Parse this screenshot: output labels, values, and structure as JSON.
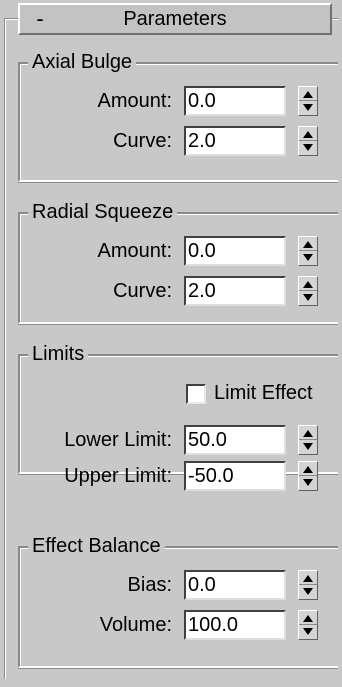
{
  "rollout": {
    "toggle": "-",
    "title": "Parameters"
  },
  "axial_bulge": {
    "title": "Axial Bulge",
    "amount_label": "Amount:",
    "amount_value": "0.0",
    "curve_label": "Curve:",
    "curve_value": "2.0"
  },
  "radial_squeeze": {
    "title": "Radial Squeeze",
    "amount_label": "Amount:",
    "amount_value": "0.0",
    "curve_label": "Curve:",
    "curve_value": "2.0"
  },
  "limits": {
    "title": "Limits",
    "limit_effect_label": "Limit Effect",
    "limit_effect_checked": false,
    "lower_label": "Lower Limit:",
    "lower_value": "50.0",
    "upper_label": "Upper Limit:",
    "upper_value": "-50.0"
  },
  "effect_balance": {
    "title": "Effect Balance",
    "bias_label": "Bias:",
    "bias_value": "0.0",
    "volume_label": "Volume:",
    "volume_value": "100.0"
  }
}
